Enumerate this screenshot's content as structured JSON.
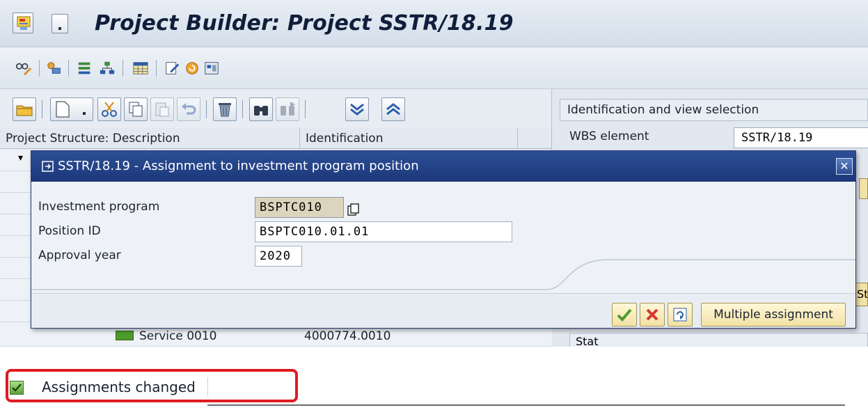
{
  "window": {
    "title": "Project Builder: Project SSTR/18.19"
  },
  "tree": {
    "headers": [
      "Project Structure: Description",
      "Identification"
    ],
    "partial_row": {
      "description": "Service 0010",
      "identification": "4000774.0010"
    }
  },
  "view_selection": {
    "header": "Identification and view selection",
    "wbs_label": "WBS element",
    "wbs_value": "SSTR/18.19",
    "status_header": "Stat",
    "partial_button": "St"
  },
  "dialog": {
    "title": "SSTR/18.19 - Assignment to investment program position",
    "fields": [
      {
        "label": "Investment program",
        "value": "BSPTC010"
      },
      {
        "label": "Position ID",
        "value": "BSPTC010.01.01"
      },
      {
        "label": "Approval year",
        "value": "2020"
      }
    ],
    "multiple_assignment_label": "Multiple assignment"
  },
  "status": {
    "message": "Assignments changed"
  },
  "colors": {
    "dialog_title_bg": "#1c377a",
    "highlight_red": "#e01b22",
    "success_green": "#5ea33a",
    "button_yellow": "#f3e2a6"
  }
}
